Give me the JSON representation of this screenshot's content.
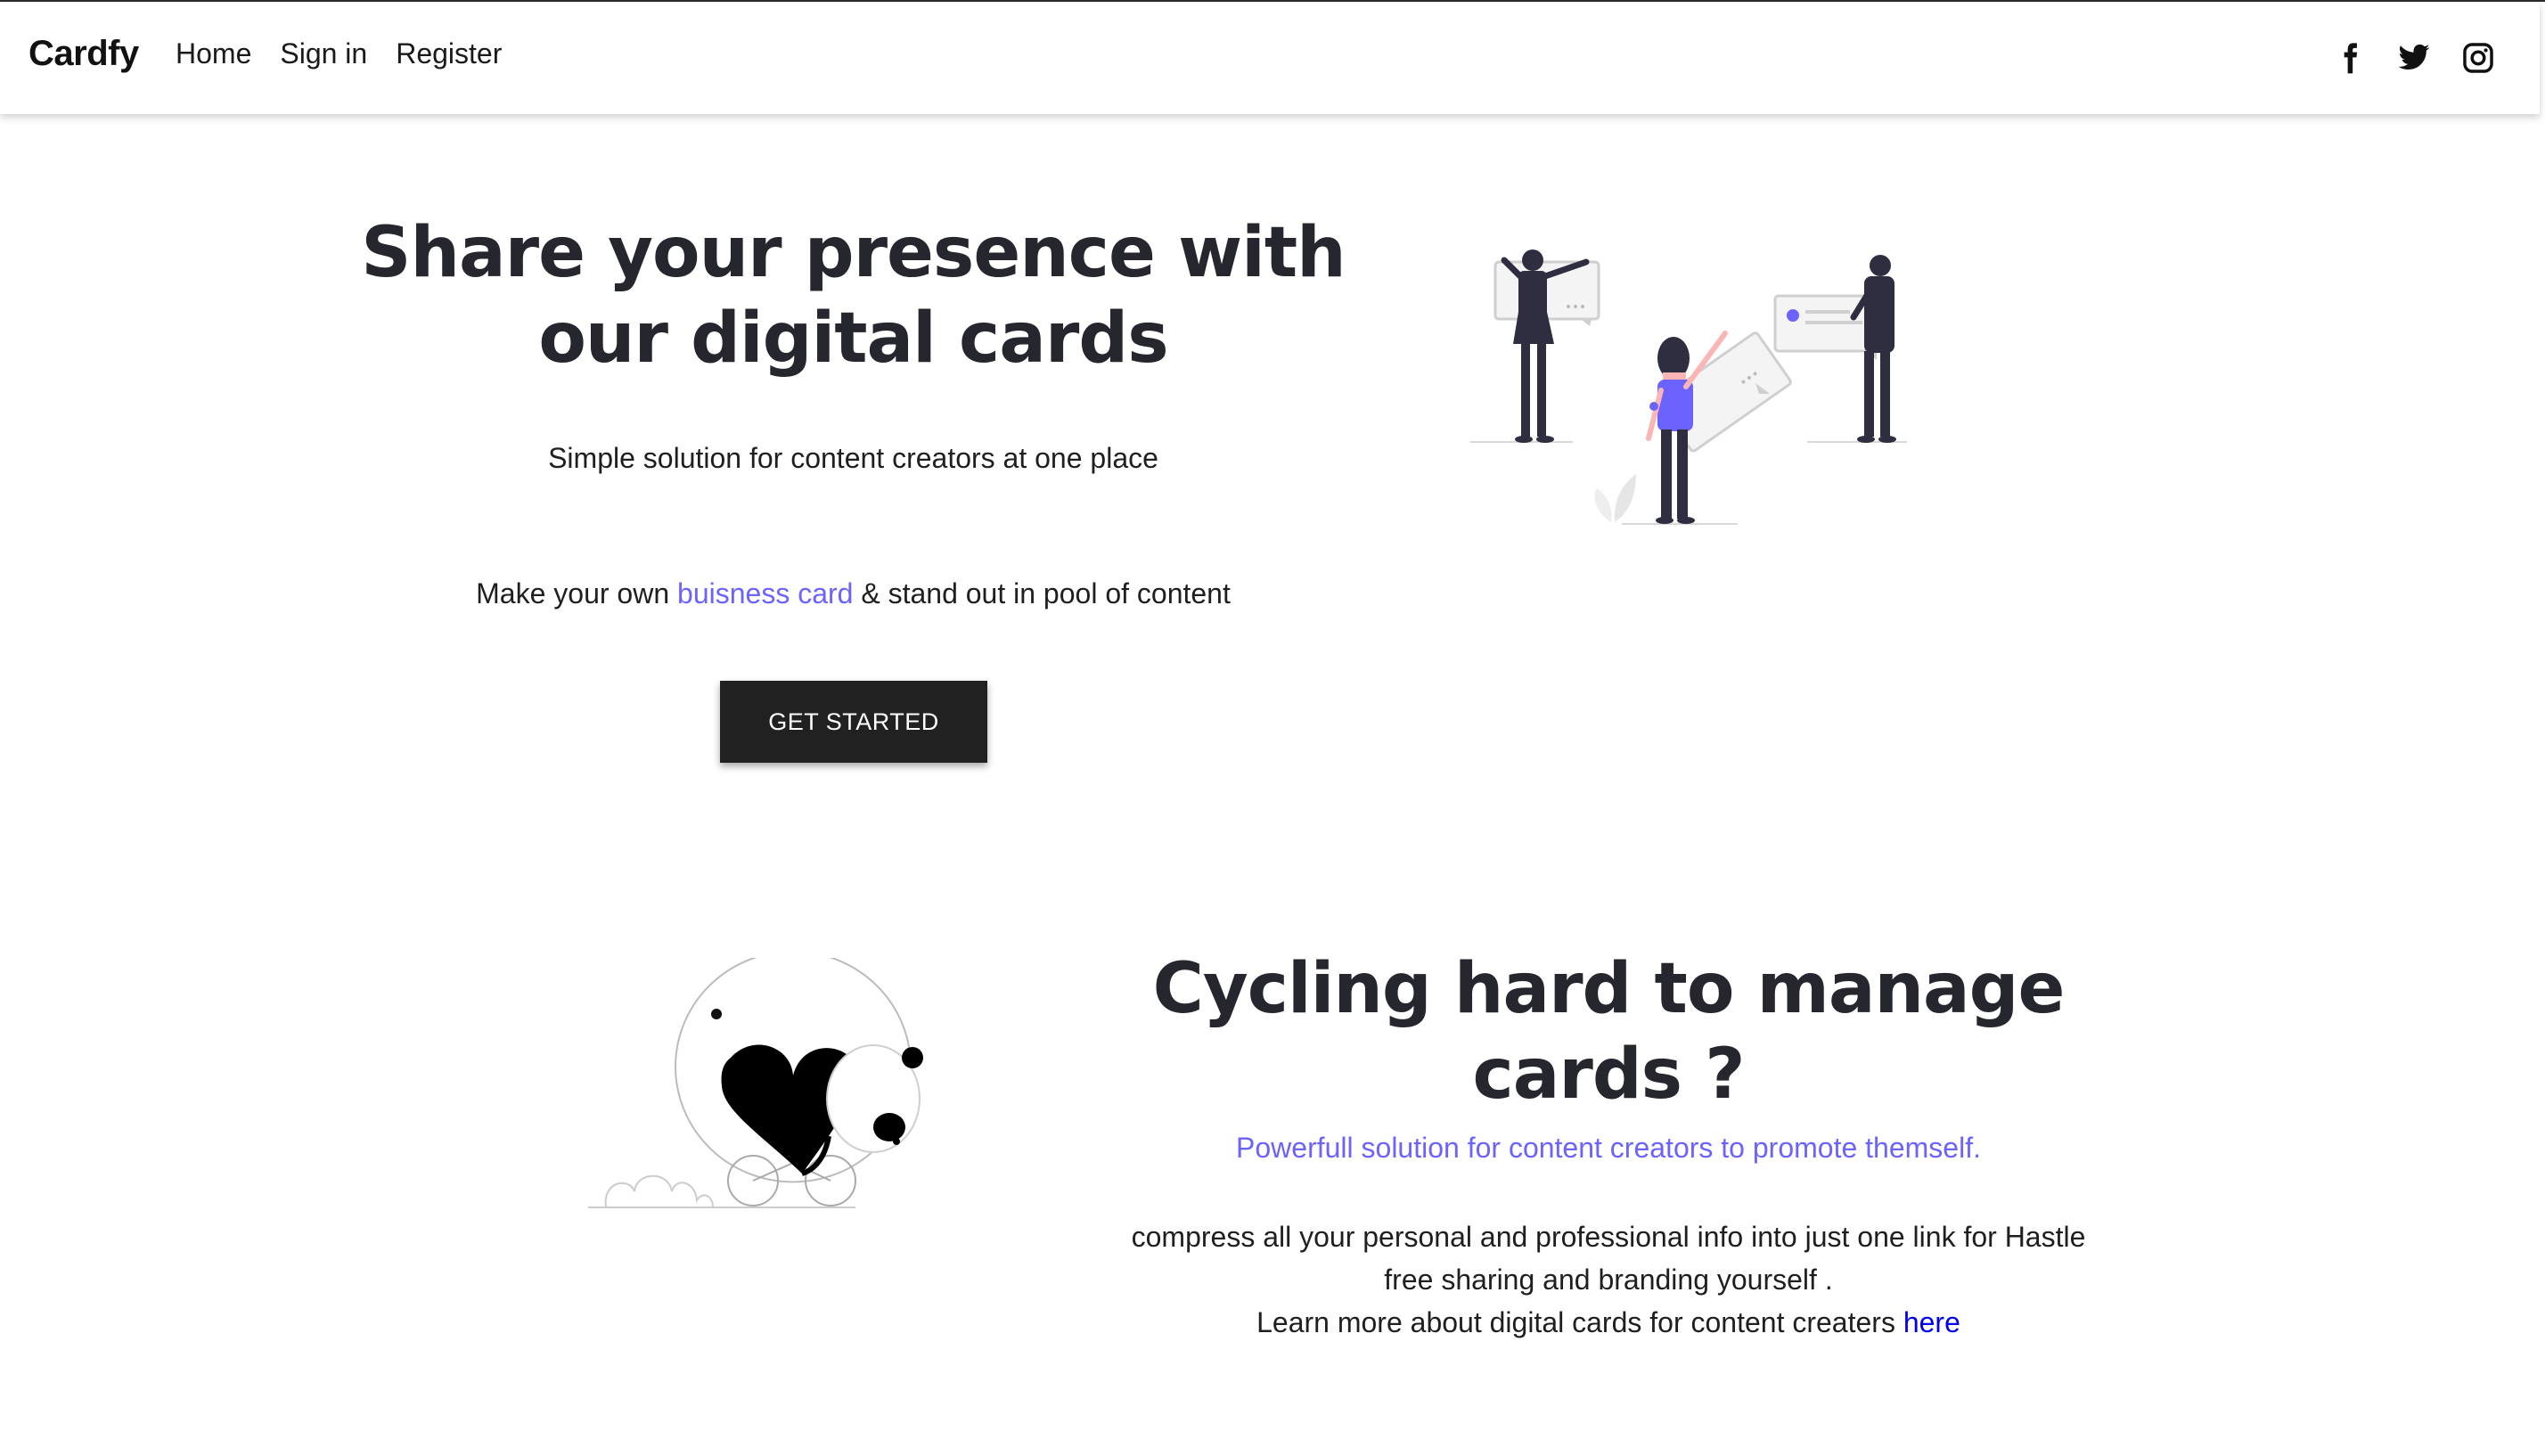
{
  "navbar": {
    "brand": "Cardfy",
    "links": [
      "Home",
      "Sign in",
      "Register"
    ],
    "social_icons": [
      "facebook-icon",
      "twitter-icon",
      "instagram-icon"
    ]
  },
  "hero": {
    "title_line1": "Share your presence with",
    "title_line2": "our digital cards",
    "subtitle": "Simple solution for content creators at one place",
    "line_prefix": "Make your own ",
    "line_link": "buisness card",
    "line_suffix": " & stand out in pool of content",
    "cta_label": "GET STARTED"
  },
  "section2": {
    "title_line1": "Cycling hard to manage",
    "title_line2": "cards ?",
    "subtitle": "Powerfull solution for content creators to promote themself.",
    "body_line1": "compress all your personal and professional info into just one link for Hastle",
    "body_line2": "free sharing and branding yourself .",
    "body_line3_prefix": "Learn more about digital cards for content creaters ",
    "body_line3_link": "here"
  },
  "colors": {
    "accent": "#6c63ff",
    "dark": "#26262e",
    "button": "#212121",
    "link": "#0000ee"
  }
}
